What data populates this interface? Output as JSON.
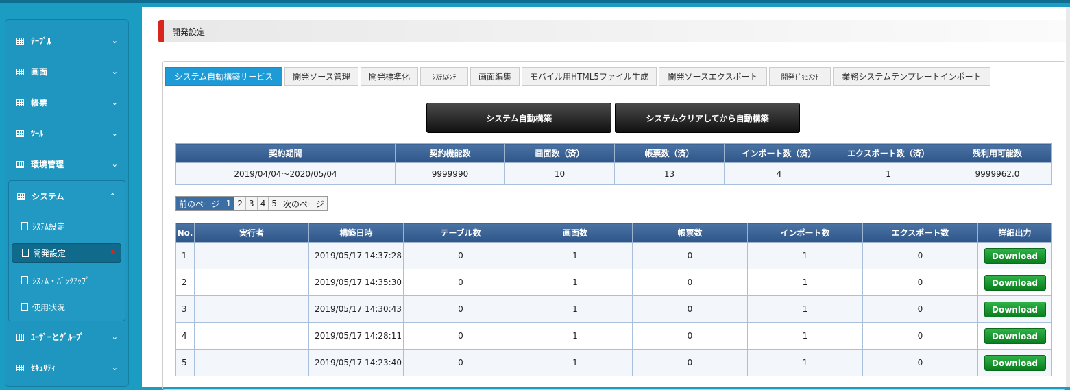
{
  "sidebar": {
    "items": [
      {
        "label": "ﾃｰﾌﾞﾙ",
        "icon": "grid-icon",
        "chevron": "⌄"
      },
      {
        "label": "画面",
        "icon": "grid-icon",
        "chevron": "⌄"
      },
      {
        "label": "帳票",
        "icon": "grid-icon",
        "chevron": "⌄"
      },
      {
        "label": "ﾂｰﾙ",
        "icon": "grid-icon",
        "chevron": "⌄"
      },
      {
        "label": "環境管理",
        "icon": "grid-icon",
        "chevron": "⌄"
      },
      {
        "label": "システム",
        "icon": "grid-icon",
        "chevron": "⌃"
      },
      {
        "label": "ﾕｰｻﾞｰとｸﾞﾙｰﾌﾟ",
        "icon": "grid-icon",
        "chevron": "⌄"
      },
      {
        "label": "ｾｷｭﾘﾃｨ",
        "icon": "grid-icon",
        "chevron": "⌄"
      }
    ],
    "system_sub": [
      {
        "label": "ｼｽﾃﾑ設定",
        "icon": "document-icon"
      },
      {
        "label": "開発設定",
        "icon": "document-icon",
        "active": true
      },
      {
        "label": "ｼｽﾃﾑ・ﾊﾞｯｸｱｯﾌﾟ",
        "icon": "document-icon"
      },
      {
        "label": "使用状況",
        "icon": "document-icon"
      }
    ]
  },
  "page": {
    "title": "開発設定"
  },
  "tabs": [
    "システム自動構築サービス",
    "開発ソース管理",
    "開発標準化",
    "ｼｽﾃﾑﾒﾝﾃ",
    "画面編集",
    "モバイル用HTML5ファイル生成",
    "開発ソースエクスポート",
    "開発ﾄﾞｷｭﾒﾝﾄ",
    "業務システムテンプレートインポート"
  ],
  "buttons": {
    "auto_build": "システム自動構築",
    "clear_build": "システムクリアしてから自動構築"
  },
  "contract": {
    "headers": [
      "契約期間",
      "契約機能数",
      "画面数（済）",
      "帳票数（済）",
      "インポート数（済）",
      "エクスポート数（済）",
      "残利用可能数"
    ],
    "values": [
      "2019/04/04～2020/05/04",
      "9999990",
      "10",
      "13",
      "4",
      "1",
      "9999962.0"
    ]
  },
  "pager": {
    "prev": "前のページ",
    "pages": [
      "1",
      "2",
      "3",
      "4",
      "5"
    ],
    "current": "1",
    "next": "次のページ"
  },
  "history": {
    "headers": [
      "No.",
      "実行者",
      "構築日時",
      "テーブル数",
      "画面数",
      "帳票数",
      "インポート数",
      "エクスポート数",
      "詳細出力"
    ],
    "download_label": "Download",
    "rows": [
      {
        "no": "1",
        "user": "",
        "date": "2019/05/17 14:37:28",
        "tables": "0",
        "screens": "1",
        "reports": "0",
        "imports": "1",
        "exports": "0"
      },
      {
        "no": "2",
        "user": "",
        "date": "2019/05/17 14:35:30",
        "tables": "0",
        "screens": "1",
        "reports": "0",
        "imports": "1",
        "exports": "0"
      },
      {
        "no": "3",
        "user": "",
        "date": "2019/05/17 14:30:43",
        "tables": "0",
        "screens": "1",
        "reports": "0",
        "imports": "1",
        "exports": "0"
      },
      {
        "no": "4",
        "user": "",
        "date": "2019/05/17 14:28:11",
        "tables": "0",
        "screens": "1",
        "reports": "0",
        "imports": "1",
        "exports": "0"
      },
      {
        "no": "5",
        "user": "",
        "date": "2019/05/17 14:23:40",
        "tables": "0",
        "screens": "1",
        "reports": "0",
        "imports": "1",
        "exports": "0"
      }
    ]
  },
  "colors": {
    "sidebar": "#1a9cc3",
    "accent_red": "#d8251d",
    "tab_active": "#1e9bd7",
    "table_header": "#3a6ea5",
    "download_green": "#1a9a32"
  }
}
